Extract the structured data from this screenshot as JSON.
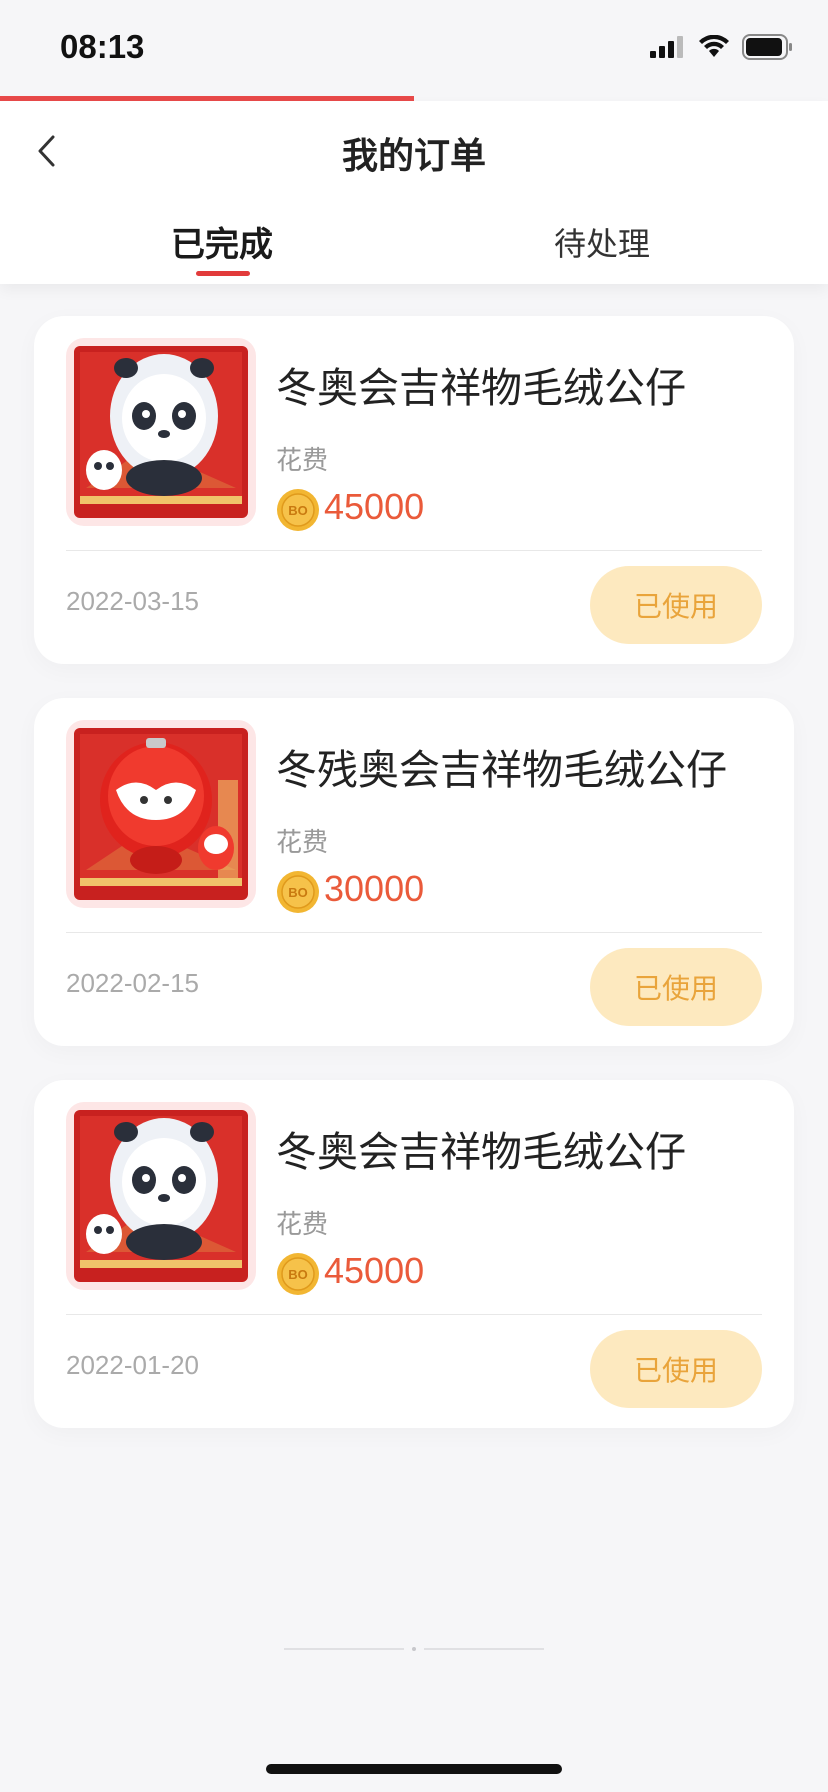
{
  "status_bar": {
    "time": "08:13"
  },
  "header": {
    "title": "我的订单"
  },
  "tabs": [
    {
      "label": "已完成",
      "active": true
    },
    {
      "label": "待处理",
      "active": false
    }
  ],
  "orders": [
    {
      "name": "冬奥会吉祥物毛绒公仔",
      "cost_label": "花费",
      "coin_label": "BO",
      "price": "45000",
      "date": "2022-03-15",
      "status": "已使用",
      "mascot": "panda"
    },
    {
      "name": "冬残奥会吉祥物毛绒公仔",
      "cost_label": "花费",
      "coin_label": "BO",
      "price": "30000",
      "date": "2022-02-15",
      "status": "已使用",
      "mascot": "lantern"
    },
    {
      "name": "冬奥会吉祥物毛绒公仔",
      "cost_label": "花费",
      "coin_label": "BO",
      "price": "45000",
      "date": "2022-01-20",
      "status": "已使用",
      "mascot": "panda"
    }
  ],
  "colors": {
    "accent_red": "#e23b3b",
    "price": "#ea5a3a",
    "used_bg": "#fde9bf",
    "used_text": "#e9a43b"
  }
}
